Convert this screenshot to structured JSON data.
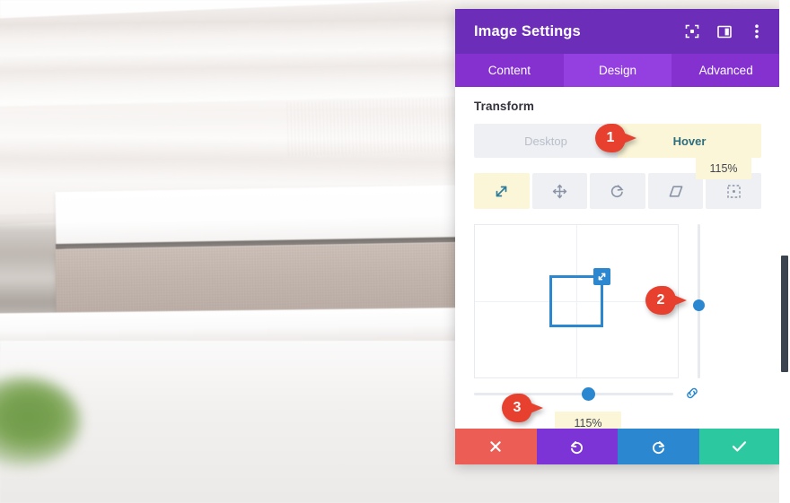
{
  "background": {
    "description": "blurred-photo-of-stacked-books-on-white-shelf"
  },
  "panel": {
    "title": "Image Settings",
    "header_icons": [
      {
        "name": "focus-target-icon",
        "glyph": "focus"
      },
      {
        "name": "layout-panel-icon",
        "glyph": "panel"
      },
      {
        "name": "more-options-icon",
        "glyph": "kebab"
      }
    ],
    "tabs": [
      {
        "label": "Content",
        "active": false
      },
      {
        "label": "Design",
        "active": true
      },
      {
        "label": "Advanced",
        "active": false
      }
    ],
    "section": {
      "title": "Transform"
    },
    "state_toggle": {
      "options": [
        {
          "label": "Desktop",
          "active": false
        },
        {
          "label": "Hover",
          "active": true
        }
      ]
    },
    "transform_tools": [
      {
        "name": "scale-tool",
        "label": "Scale",
        "active": true
      },
      {
        "name": "move-tool",
        "label": "Move",
        "active": false
      },
      {
        "name": "rotate-tool",
        "label": "Rotate",
        "active": false
      },
      {
        "name": "skew-tool",
        "label": "Skew",
        "active": false
      },
      {
        "name": "origin-tool",
        "label": "Transform Origin",
        "active": false
      }
    ],
    "canvas": {
      "shape_handle_icon": "resize-diagonal-icon"
    },
    "vertical_slider": {
      "value": "115%"
    },
    "horizontal_slider": {
      "value": "115%",
      "link_icon": "link-chain-icon"
    },
    "actions": [
      {
        "name": "cancel-button",
        "icon": "close-icon",
        "color": "#ec5d55"
      },
      {
        "name": "undo-button",
        "icon": "undo-icon",
        "color": "#7d34d6"
      },
      {
        "name": "redo-button",
        "icon": "redo-icon",
        "color": "#2a87d0"
      },
      {
        "name": "save-button",
        "icon": "check-icon",
        "color": "#2cc8a0"
      }
    ],
    "colors": {
      "header": "#6c2eb9",
      "tabbar": "#8431cf",
      "tab_active": "#9440e0",
      "accent_blue": "#2a87d0",
      "highlight_yellow": "#fbf6d8",
      "marker_red": "#e8402e"
    }
  },
  "markers": [
    {
      "number": "1"
    },
    {
      "number": "2"
    },
    {
      "number": "3"
    }
  ]
}
